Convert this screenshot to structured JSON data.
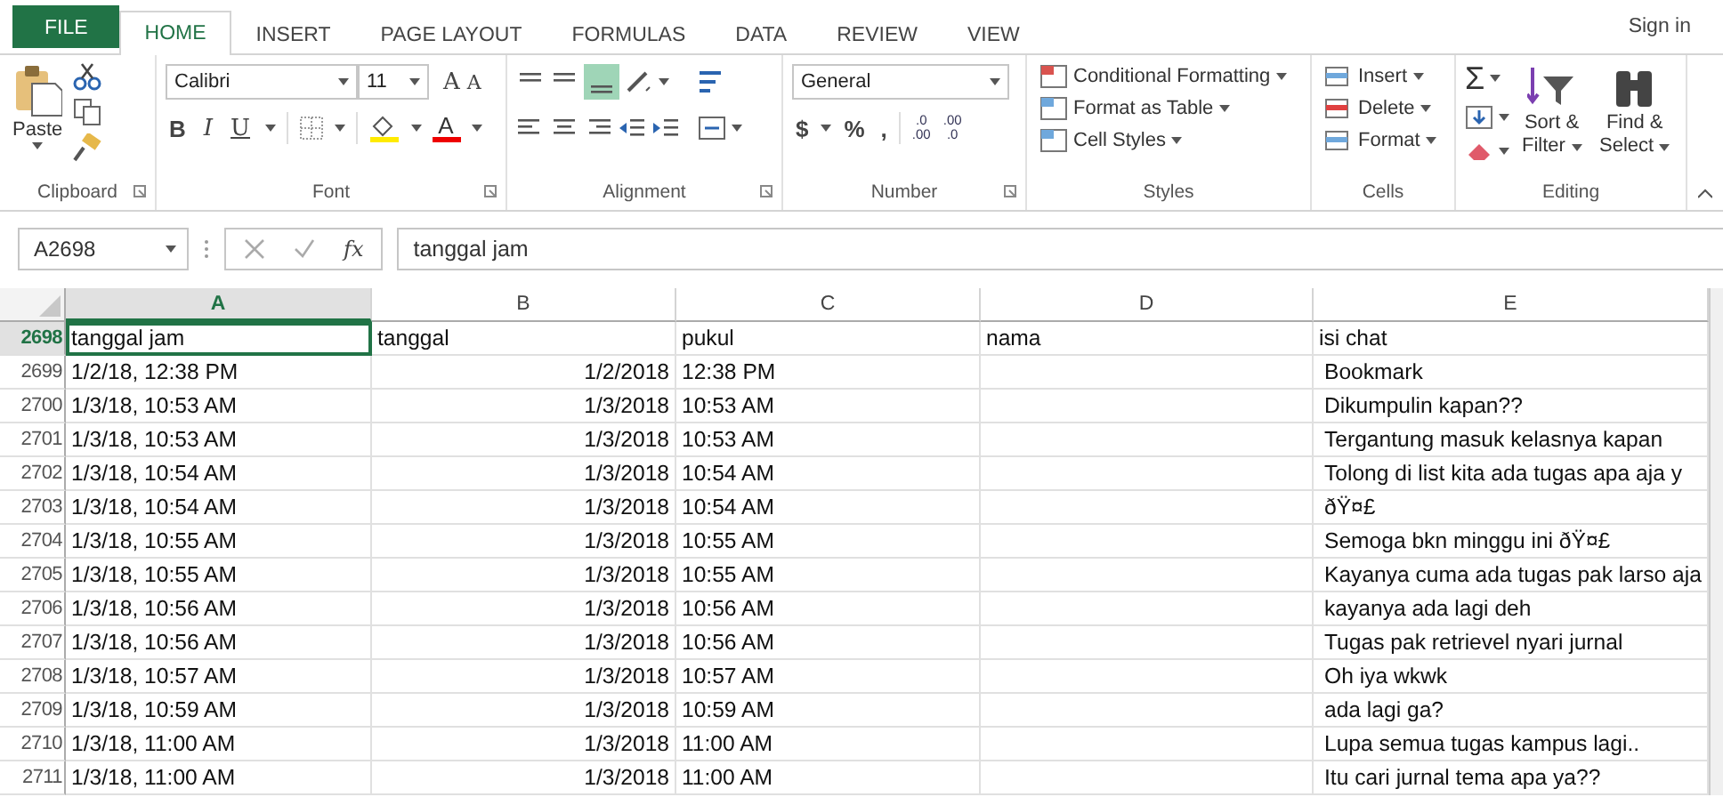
{
  "ribbon_tabs": [
    {
      "label": "FILE",
      "kind": "file",
      "selected": false
    },
    {
      "label": "HOME",
      "kind": "tab",
      "selected": true
    },
    {
      "label": "INSERT",
      "kind": "tab",
      "selected": false
    },
    {
      "label": "PAGE LAYOUT",
      "kind": "tab",
      "selected": false
    },
    {
      "label": "FORMULAS",
      "kind": "tab",
      "selected": false
    },
    {
      "label": "DATA",
      "kind": "tab",
      "selected": false
    },
    {
      "label": "REVIEW",
      "kind": "tab",
      "selected": false
    },
    {
      "label": "VIEW",
      "kind": "tab",
      "selected": false
    }
  ],
  "sign_in": "Sign in",
  "clipboard": {
    "label": "Clipboard",
    "paste": "Paste"
  },
  "font": {
    "label": "Font",
    "font_name": "Calibri",
    "font_size": "11",
    "grow": "A",
    "shrink": "A",
    "bold": "B",
    "italic": "I",
    "underline": "U",
    "font_color": "A"
  },
  "alignment": {
    "label": "Alignment"
  },
  "number": {
    "label": "Number",
    "format": "General",
    "currency": "$",
    "percent": "%",
    "comma": ",",
    "increase_decimal": [
      ".0",
      ".00"
    ],
    "decrease_decimal": [
      ".00",
      ".0"
    ]
  },
  "styles": {
    "label": "Styles",
    "items": [
      "Conditional Formatting",
      "Format as Table",
      "Cell Styles"
    ]
  },
  "cells": {
    "label": "Cells",
    "items": [
      "Insert",
      "Delete",
      "Format"
    ]
  },
  "editing": {
    "label": "Editing",
    "autosum": "Σ",
    "sort": [
      "Sort &",
      "Filter"
    ],
    "find": [
      "Find &",
      "Select"
    ]
  },
  "formula_bar": {
    "name_box": "A2698",
    "fx": "fx",
    "value": "tanggal jam"
  },
  "columns": [
    {
      "label": "A",
      "selected": true
    },
    {
      "label": "B",
      "selected": false
    },
    {
      "label": "C",
      "selected": false
    },
    {
      "label": "D",
      "selected": false
    },
    {
      "label": "E",
      "selected": false
    }
  ],
  "header_row": {
    "number": "2698",
    "selected": true,
    "cells": [
      {
        "text": "tanggal jam",
        "active": true
      },
      {
        "text": "tanggal",
        "active": false
      },
      {
        "text": "pukul",
        "active": false
      },
      {
        "text": "nama",
        "active": false
      },
      {
        "text": "isi chat",
        "active": false
      }
    ]
  },
  "rows": [
    {
      "number": "2699",
      "tanggal_jam": "1/2/18, 12:38 PM",
      "tanggal": "1/2/2018",
      "pukul": "12:38 PM",
      "isi_chat": "Bookmark"
    },
    {
      "number": "2700",
      "tanggal_jam": "1/3/18, 10:53 AM",
      "tanggal": "1/3/2018",
      "pukul": "10:53 AM",
      "isi_chat": "Dikumpulin kapan??"
    },
    {
      "number": "2701",
      "tanggal_jam": "1/3/18, 10:53 AM",
      "tanggal": "1/3/2018",
      "pukul": "10:53 AM",
      "isi_chat": "Tergantung masuk kelasnya kapan"
    },
    {
      "number": "2702",
      "tanggal_jam": "1/3/18, 10:54 AM",
      "tanggal": "1/3/2018",
      "pukul": "10:54 AM",
      "isi_chat": "Tolong di list kita ada tugas apa aja y"
    },
    {
      "number": "2703",
      "tanggal_jam": "1/3/18, 10:54 AM",
      "tanggal": "1/3/2018",
      "pukul": "10:54 AM",
      "isi_chat": "ðŸ¤£"
    },
    {
      "number": "2704",
      "tanggal_jam": "1/3/18, 10:55 AM",
      "tanggal": "1/3/2018",
      "pukul": "10:55 AM",
      "isi_chat": "Semoga bkn minggu ini ðŸ¤£"
    },
    {
      "number": "2705",
      "tanggal_jam": "1/3/18, 10:55 AM",
      "tanggal": "1/3/2018",
      "pukul": "10:55 AM",
      "isi_chat": "Kayanya cuma ada tugas pak larso aja"
    },
    {
      "number": "2706",
      "tanggal_jam": "1/3/18, 10:56 AM",
      "tanggal": "1/3/2018",
      "pukul": "10:56 AM",
      "isi_chat": "kayanya ada lagi deh"
    },
    {
      "number": "2707",
      "tanggal_jam": "1/3/18, 10:56 AM",
      "tanggal": "1/3/2018",
      "pukul": "10:56 AM",
      "isi_chat": "Tugas pak retrievel nyari jurnal"
    },
    {
      "number": "2708",
      "tanggal_jam": "1/3/18, 10:57 AM",
      "tanggal": "1/3/2018",
      "pukul": "10:57 AM",
      "isi_chat": "Oh iya wkwk"
    },
    {
      "number": "2709",
      "tanggal_jam": "1/3/18, 10:59 AM",
      "tanggal": "1/3/2018",
      "pukul": "10:59 AM",
      "isi_chat": "ada lagi ga?"
    },
    {
      "number": "2710",
      "tanggal_jam": "1/3/18, 11:00 AM",
      "tanggal": "1/3/2018",
      "pukul": "11:00 AM",
      "isi_chat": "Lupa semua tugas kampus lagi.."
    },
    {
      "number": "2711",
      "tanggal_jam": "1/3/18, 11:00 AM",
      "tanggal": "1/3/2018",
      "pukul": "11:00 AM",
      "isi_chat": "Itu cari jurnal tema apa ya??"
    }
  ]
}
